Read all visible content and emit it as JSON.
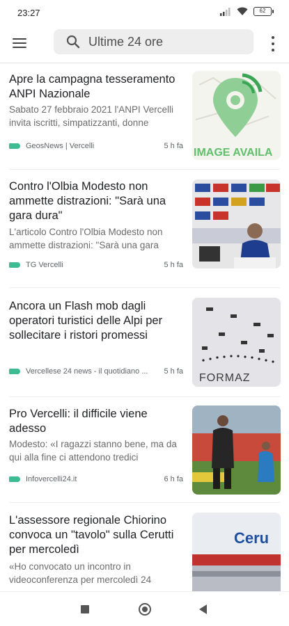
{
  "status_bar": {
    "time": "23:27",
    "battery": "62",
    "icons": [
      "signal-icon",
      "wifi-icon",
      "battery-icon"
    ]
  },
  "app_bar": {
    "menu_icon": "hamburger-menu-icon",
    "search_icon": "search-icon",
    "search_text": "Ultime 24 ore",
    "more_icon": "more-vert-icon"
  },
  "colors": {
    "source_tag": "#3dbb92",
    "headline": "#202124",
    "snippet": "#6b6b6b"
  },
  "articles": [
    {
      "headline": "Apre la campagna tesseramento ANPI Nazionale",
      "snippet": "Sabato 27 febbraio 2021 l'ANPI Vercelli invita iscritti, simpatizzanti, donne",
      "source": "GeosNews | Vercelli",
      "time": "5 h fa",
      "image_text": "IMAGE AVAILA"
    },
    {
      "headline": "Contro l'Olbia Modesto non ammette distrazioni: \"Sarà una gara dura\"",
      "snippet": "L'articolo Contro l'Olbia Modesto non ammette distrazioni: \"Sarà una gara",
      "source": "TG Vercelli",
      "time": "5 h fa"
    },
    {
      "headline": "Ancora un Flash mob dagli operatori turistici delle Alpi per sollecitare i ristori promessi",
      "snippet": "",
      "source": "Vercellese 24 news - il quotidiano ...",
      "time": "5 h fa",
      "image_text": "FORMAZ"
    },
    {
      "headline": "Pro Vercelli: il difficile viene adesso",
      "snippet": "Modesto: «I ragazzi stanno bene, ma da qui alla fine ci attendono tredici",
      "source": "Infovercelli24.it",
      "time": "6 h fa"
    },
    {
      "headline": "L'assessore regionale Chiorino convoca un \"tavolo\" sulla Cerutti per mercoledì",
      "snippet": "«Ho convocato un incontro in videoconferenza per mercoledì 24",
      "source": "",
      "time": "",
      "image_text": "Ceru"
    }
  ],
  "nav_bar": {
    "recents_icon": "recents-square-icon",
    "home_icon": "home-circle-icon",
    "back_icon": "back-triangle-icon"
  }
}
